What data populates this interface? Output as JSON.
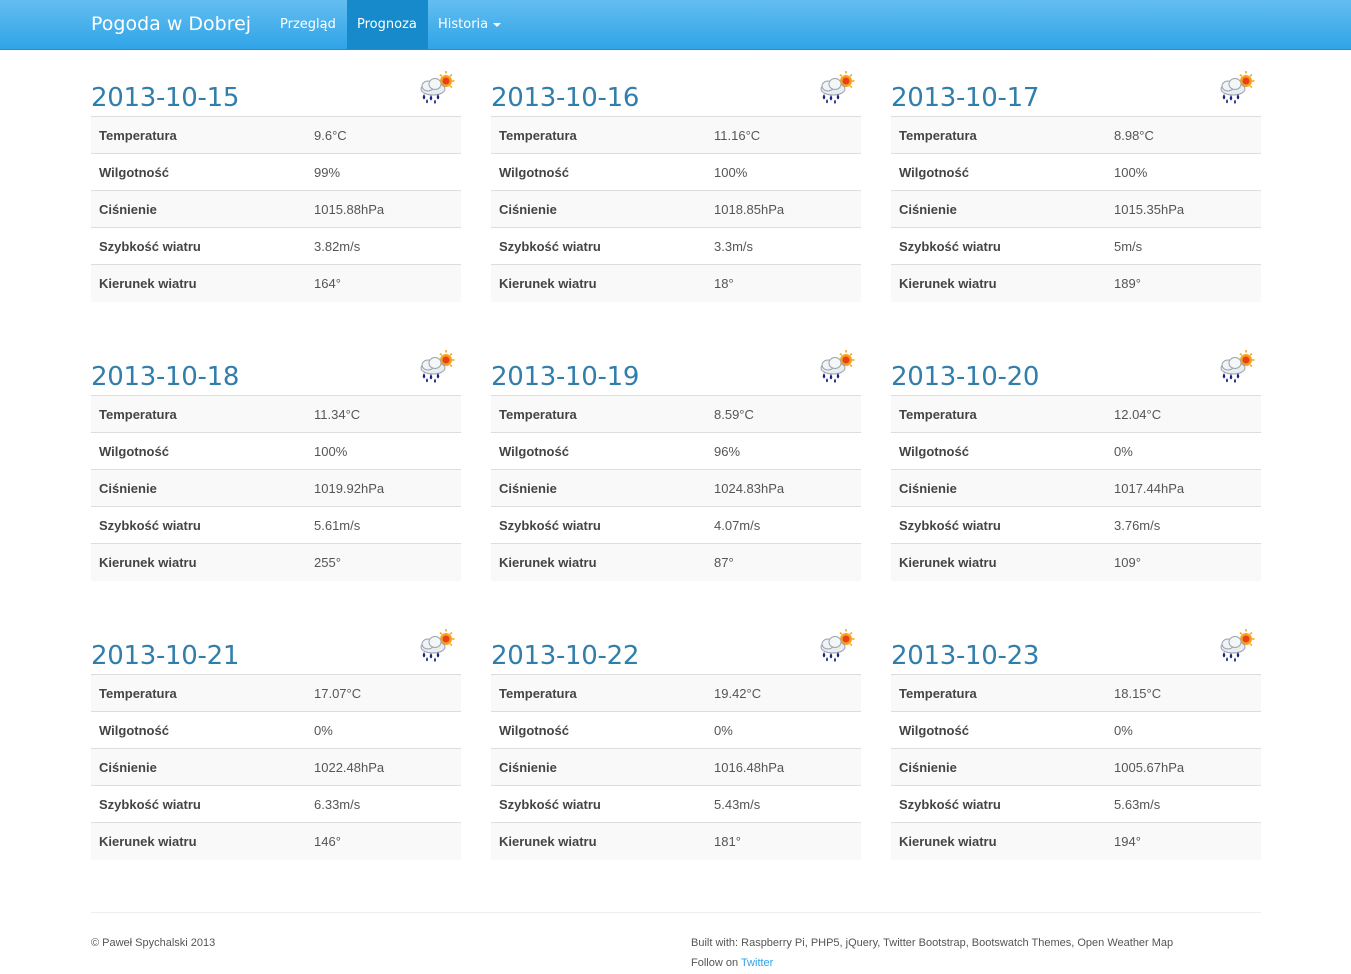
{
  "navbar": {
    "brand": "Pogoda w Dobrej",
    "items": [
      {
        "label": "Przegląd",
        "active": false
      },
      {
        "label": "Prognoza",
        "active": true
      },
      {
        "label": "Historia",
        "active": false,
        "dropdown": true
      }
    ]
  },
  "forecast": [
    {
      "date": "2013-10-15",
      "icon": "rain-sun-icon",
      "rows": [
        {
          "label": "Temperatura",
          "value": "9.6°C"
        },
        {
          "label": "Wilgotność",
          "value": "99%"
        },
        {
          "label": "Ciśnienie",
          "value": "1015.88hPa"
        },
        {
          "label": "Szybkość wiatru",
          "value": "3.82m/s"
        },
        {
          "label": "Kierunek wiatru",
          "value": "164°"
        }
      ]
    },
    {
      "date": "2013-10-16",
      "icon": "rain-sun-icon",
      "rows": [
        {
          "label": "Temperatura",
          "value": "11.16°C"
        },
        {
          "label": "Wilgotność",
          "value": "100%"
        },
        {
          "label": "Ciśnienie",
          "value": "1018.85hPa"
        },
        {
          "label": "Szybkość wiatru",
          "value": "3.3m/s"
        },
        {
          "label": "Kierunek wiatru",
          "value": "18°"
        }
      ]
    },
    {
      "date": "2013-10-17",
      "icon": "rain-sun-icon",
      "rows": [
        {
          "label": "Temperatura",
          "value": "8.98°C"
        },
        {
          "label": "Wilgotność",
          "value": "100%"
        },
        {
          "label": "Ciśnienie",
          "value": "1015.35hPa"
        },
        {
          "label": "Szybkość wiatru",
          "value": "5m/s"
        },
        {
          "label": "Kierunek wiatru",
          "value": "189°"
        }
      ]
    },
    {
      "date": "2013-10-18",
      "icon": "rain-sun-icon",
      "rows": [
        {
          "label": "Temperatura",
          "value": "11.34°C"
        },
        {
          "label": "Wilgotność",
          "value": "100%"
        },
        {
          "label": "Ciśnienie",
          "value": "1019.92hPa"
        },
        {
          "label": "Szybkość wiatru",
          "value": "5.61m/s"
        },
        {
          "label": "Kierunek wiatru",
          "value": "255°"
        }
      ]
    },
    {
      "date": "2013-10-19",
      "icon": "rain-sun-icon",
      "rows": [
        {
          "label": "Temperatura",
          "value": "8.59°C"
        },
        {
          "label": "Wilgotność",
          "value": "96%"
        },
        {
          "label": "Ciśnienie",
          "value": "1024.83hPa"
        },
        {
          "label": "Szybkość wiatru",
          "value": "4.07m/s"
        },
        {
          "label": "Kierunek wiatru",
          "value": "87°"
        }
      ]
    },
    {
      "date": "2013-10-20",
      "icon": "rain-sun-icon",
      "rows": [
        {
          "label": "Temperatura",
          "value": "12.04°C"
        },
        {
          "label": "Wilgotność",
          "value": "0%"
        },
        {
          "label": "Ciśnienie",
          "value": "1017.44hPa"
        },
        {
          "label": "Szybkość wiatru",
          "value": "3.76m/s"
        },
        {
          "label": "Kierunek wiatru",
          "value": "109°"
        }
      ]
    },
    {
      "date": "2013-10-21",
      "icon": "rain-sun-icon",
      "rows": [
        {
          "label": "Temperatura",
          "value": "17.07°C"
        },
        {
          "label": "Wilgotność",
          "value": "0%"
        },
        {
          "label": "Ciśnienie",
          "value": "1022.48hPa"
        },
        {
          "label": "Szybkość wiatru",
          "value": "6.33m/s"
        },
        {
          "label": "Kierunek wiatru",
          "value": "146°"
        }
      ]
    },
    {
      "date": "2013-10-22",
      "icon": "rain-sun-icon",
      "rows": [
        {
          "label": "Temperatura",
          "value": "19.42°C"
        },
        {
          "label": "Wilgotność",
          "value": "0%"
        },
        {
          "label": "Ciśnienie",
          "value": "1016.48hPa"
        },
        {
          "label": "Szybkość wiatru",
          "value": "5.43m/s"
        },
        {
          "label": "Kierunek wiatru",
          "value": "181°"
        }
      ]
    },
    {
      "date": "2013-10-23",
      "icon": "rain-sun-icon",
      "rows": [
        {
          "label": "Temperatura",
          "value": "18.15°C"
        },
        {
          "label": "Wilgotność",
          "value": "0%"
        },
        {
          "label": "Ciśnienie",
          "value": "1005.67hPa"
        },
        {
          "label": "Szybkość wiatru",
          "value": "5.63m/s"
        },
        {
          "label": "Kierunek wiatru",
          "value": "194°"
        }
      ]
    }
  ],
  "footer": {
    "copyright": "© Paweł Spychalski 2013",
    "built_with": "Built with: Raspberry Pi, PHP5, jQuery, Twitter Bootstrap, Bootswatch Themes, Open Weather Map",
    "follow_prefix": "Follow on",
    "twitter_link": "Twitter"
  },
  "colors": {
    "navbar": "#2fa4e7",
    "nav_active": "#178acc",
    "heading": "#317eac",
    "link": "#2fa4e7"
  }
}
